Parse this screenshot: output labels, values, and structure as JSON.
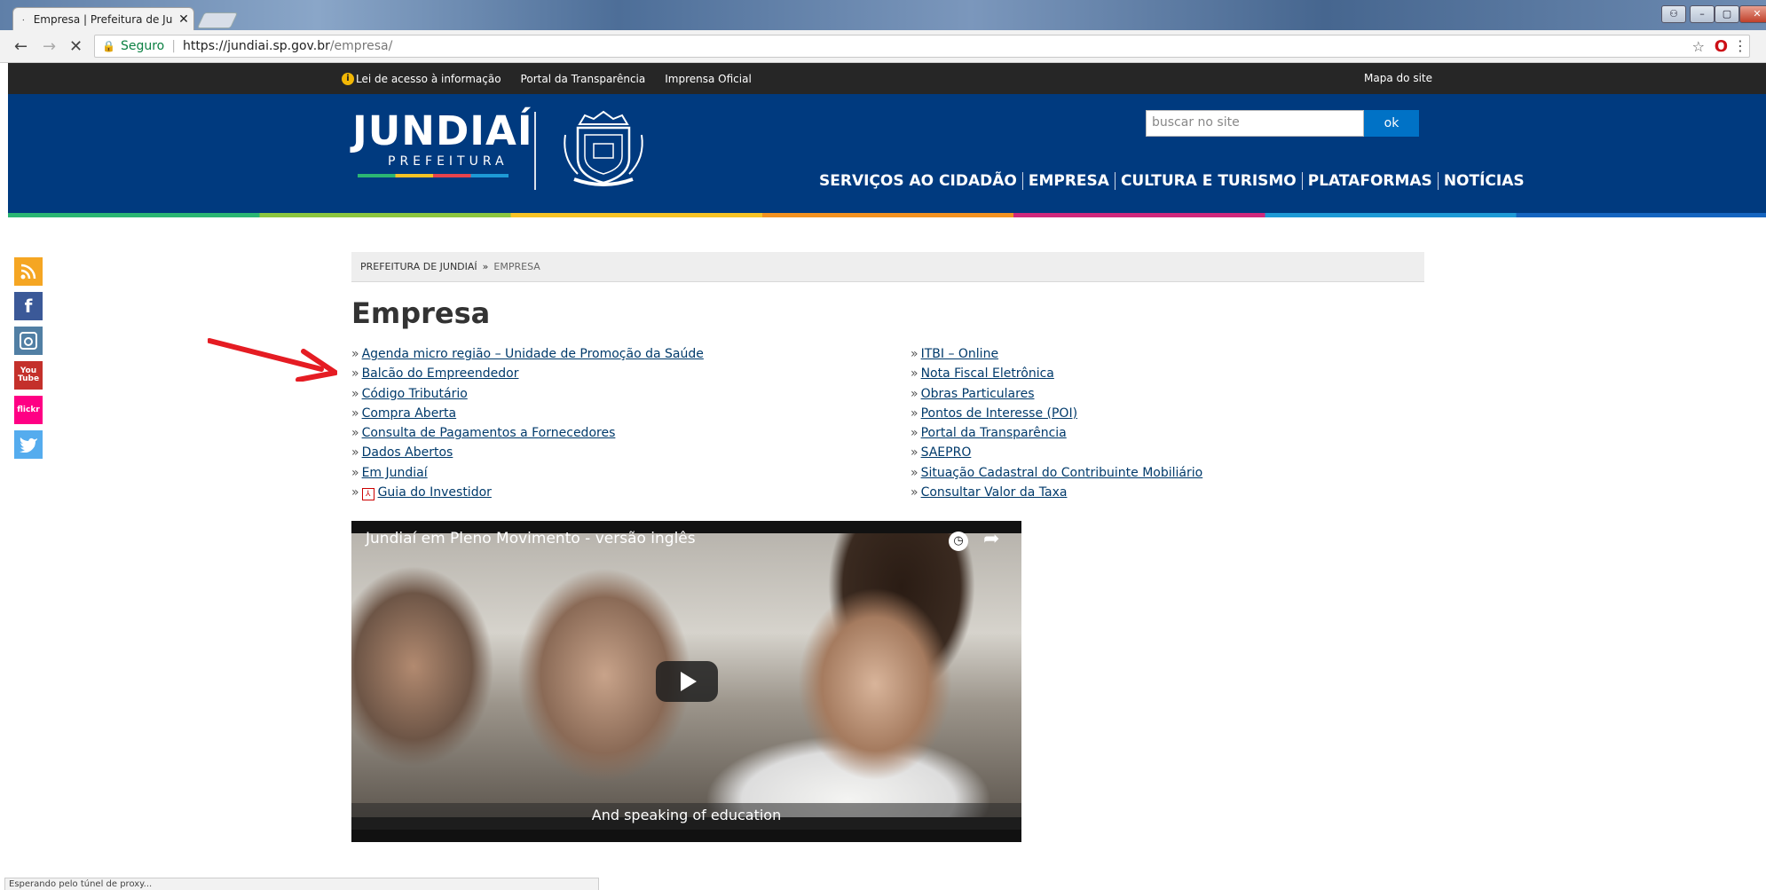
{
  "browser": {
    "tab_title": "Empresa | Prefeitura de Ju",
    "tab_close": "✕",
    "secure_label": "Seguro",
    "url_host": "https://jundiai.sp.gov.br",
    "url_path": "/empresa/",
    "status_text": "Esperando pelo túnel de proxy..."
  },
  "topbar": {
    "links": [
      "Lei de acesso à informação",
      "Portal da Transparência",
      "Imprensa Oficial"
    ],
    "sitemap": "Mapa do site"
  },
  "header": {
    "logo_main": "JUNDIAÍ",
    "logo_sub": "PREFEITURA",
    "search_placeholder": "buscar no site",
    "search_button": "ok",
    "nav": [
      "SERVIÇOS AO CIDADÃO",
      "EMPRESA",
      "CULTURA E TURISMO",
      "PLATAFORMAS",
      "NOTÍCIAS"
    ]
  },
  "social": {
    "rss_color": "#f5a623",
    "facebook_color": "#3b5998",
    "instagram_color": "#517fa4",
    "youtube_color": "#c4302b",
    "flickr_color": "#ff0084",
    "twitter_color": "#55acee",
    "flickr_label": "flickr",
    "youtube_label": "You"
  },
  "breadcrumb": {
    "home": "PREFEITURA DE JUNDIAÍ",
    "separator": "»",
    "current": "EMPRESA"
  },
  "page": {
    "title": "Empresa",
    "bullet": "»",
    "left_links": [
      "Agenda micro região – Unidade de Promoção da Saúde",
      "Balcão do Empreendedor",
      "Código Tributário",
      "Compra Aberta",
      "Consulta de Pagamentos a Fornecedores",
      "Dados Abertos",
      "Em Jundiaí",
      "Guia do Investidor"
    ],
    "right_links": [
      "ITBI – Online",
      "Nota Fiscal Eletrônica",
      "Obras Particulares",
      "Pontos de Interesse (POI)",
      "Portal da Transparência",
      "SAEPRO",
      "Situação Cadastral do Contribuinte Mobiliário",
      "Consultar Valor da Taxa"
    ]
  },
  "video": {
    "title": "Jundiaí em Pleno Movimento - versão inglês",
    "subtitle": "And speaking of education"
  }
}
